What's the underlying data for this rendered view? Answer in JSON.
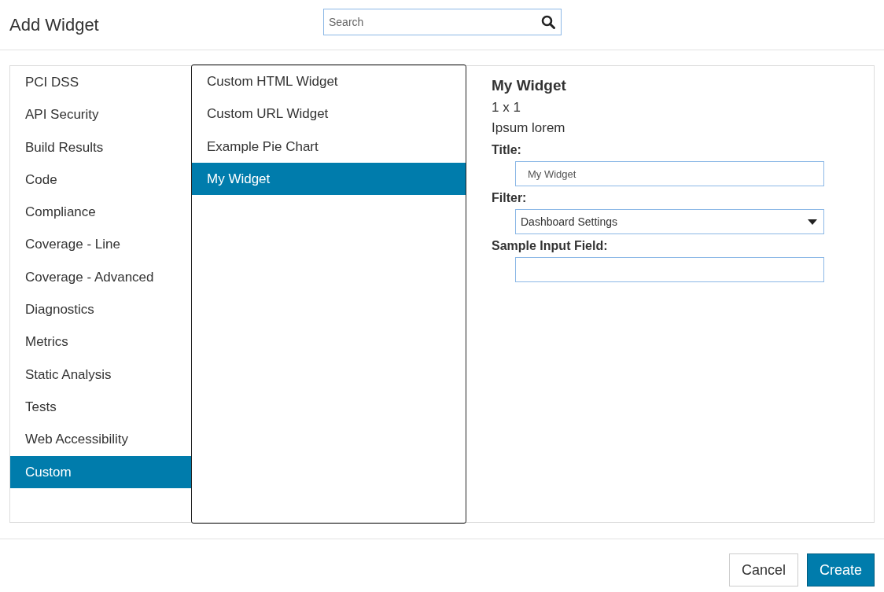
{
  "dialog": {
    "title": "Add Widget"
  },
  "search": {
    "placeholder": "Search"
  },
  "categories": [
    {
      "label": "PCI DSS",
      "selected": false
    },
    {
      "label": "API Security",
      "selected": false
    },
    {
      "label": "Build Results",
      "selected": false
    },
    {
      "label": "Code",
      "selected": false
    },
    {
      "label": "Compliance",
      "selected": false
    },
    {
      "label": "Coverage - Line",
      "selected": false
    },
    {
      "label": "Coverage - Advanced",
      "selected": false
    },
    {
      "label": "Diagnostics",
      "selected": false
    },
    {
      "label": "Metrics",
      "selected": false
    },
    {
      "label": "Static Analysis",
      "selected": false
    },
    {
      "label": "Tests",
      "selected": false
    },
    {
      "label": "Web Accessibility",
      "selected": false
    },
    {
      "label": "Custom",
      "selected": true
    }
  ],
  "widgets": [
    {
      "label": "Custom HTML Widget",
      "selected": false
    },
    {
      "label": "Custom URL Widget",
      "selected": false
    },
    {
      "label": "Example Pie Chart",
      "selected": false
    },
    {
      "label": "My Widget",
      "selected": true
    }
  ],
  "details": {
    "name": "My Widget",
    "size": "1 x 1",
    "description": "Ipsum lorem",
    "fields": [
      {
        "kind": "text",
        "label": "Title:",
        "value": "My Widget"
      },
      {
        "kind": "select",
        "label": "Filter:",
        "value": "Dashboard Settings"
      },
      {
        "kind": "text",
        "label": "Sample Input Field:"
      }
    ]
  },
  "buttons": [
    {
      "label": "Cancel",
      "kind": "secondary"
    },
    {
      "label": "Create",
      "kind": "primary"
    }
  ]
}
